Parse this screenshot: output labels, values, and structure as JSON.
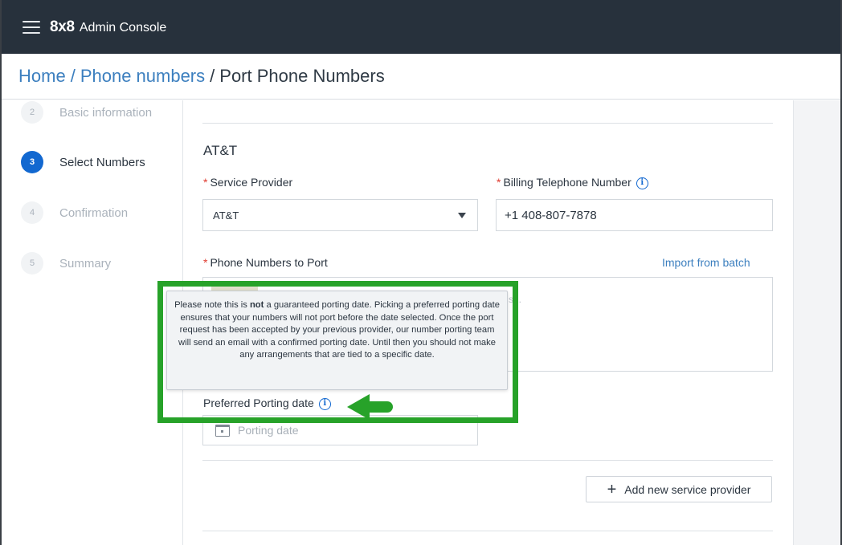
{
  "app": {
    "logo": "8x8",
    "title": "Admin Console"
  },
  "breadcrumb": {
    "home": "Home",
    "sep1": "/",
    "phone_numbers": "Phone numbers",
    "sep2": "/",
    "current": "Port Phone Numbers"
  },
  "steps": [
    {
      "num": "2",
      "label": "Basic information",
      "active": false
    },
    {
      "num": "3",
      "label": "Select Numbers",
      "active": true
    },
    {
      "num": "4",
      "label": "Confirmation",
      "active": false
    },
    {
      "num": "5",
      "label": "Summary",
      "active": false
    }
  ],
  "form": {
    "provider_title": "AT&T",
    "service_provider_label": "Service Provider",
    "service_provider_value": "AT&T",
    "billing_label": "Billing Telephone Number",
    "billing_value": "+1 408-807-7878",
    "phone_numbers_label": "Phone Numbers to Port",
    "import_link": "Import from batch",
    "textarea_placeholder_fragment": "s...",
    "porting_date_label": "Preferred Porting date",
    "porting_date_placeholder": "Porting date",
    "add_provider_button": "Add new service provider",
    "required_mark": "*"
  },
  "tooltip": {
    "before_bold": "Please note this is ",
    "bold": "not",
    "after_bold": " a guaranteed porting date. Picking a preferred porting date ensures that your numbers will not port before the date selected. Once the port request has been accepted by your previous provider, our number porting team will send an email with a confirmed porting date. Until then you should not make any arrangements that are tied to a specific date."
  },
  "icons": {
    "menu": "hamburger-menu-icon",
    "info": "info-icon",
    "dropdown": "caret-down-icon",
    "calendar": "calendar-icon",
    "add": "plus-icon",
    "annotation_arrow": "arrow-left-icon"
  },
  "colors": {
    "topbar": "#27313c",
    "link": "#3c7fbf",
    "active_step": "#1268d0",
    "required": "#e03c31",
    "highlight": "#27a229"
  }
}
